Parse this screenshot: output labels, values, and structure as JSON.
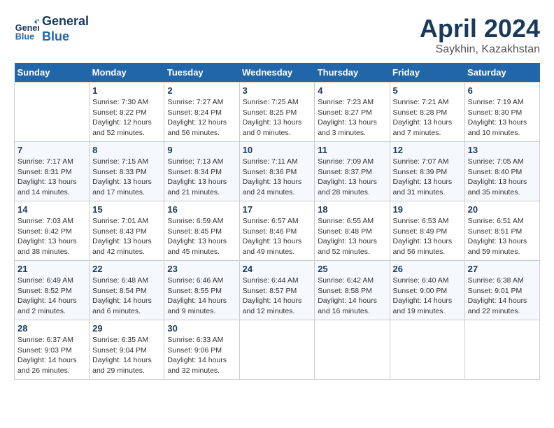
{
  "header": {
    "logo_line1": "General",
    "logo_line2": "Blue",
    "month": "April 2024",
    "location": "Saykhin, Kazakhstan"
  },
  "weekdays": [
    "Sunday",
    "Monday",
    "Tuesday",
    "Wednesday",
    "Thursday",
    "Friday",
    "Saturday"
  ],
  "weeks": [
    [
      {
        "day": "",
        "info": ""
      },
      {
        "day": "1",
        "info": "Sunrise: 7:30 AM\nSunset: 8:22 PM\nDaylight: 12 hours\nand 52 minutes."
      },
      {
        "day": "2",
        "info": "Sunrise: 7:27 AM\nSunset: 8:24 PM\nDaylight: 12 hours\nand 56 minutes."
      },
      {
        "day": "3",
        "info": "Sunrise: 7:25 AM\nSunset: 8:25 PM\nDaylight: 13 hours\nand 0 minutes."
      },
      {
        "day": "4",
        "info": "Sunrise: 7:23 AM\nSunset: 8:27 PM\nDaylight: 13 hours\nand 3 minutes."
      },
      {
        "day": "5",
        "info": "Sunrise: 7:21 AM\nSunset: 8:28 PM\nDaylight: 13 hours\nand 7 minutes."
      },
      {
        "day": "6",
        "info": "Sunrise: 7:19 AM\nSunset: 8:30 PM\nDaylight: 13 hours\nand 10 minutes."
      }
    ],
    [
      {
        "day": "7",
        "info": "Sunrise: 7:17 AM\nSunset: 8:31 PM\nDaylight: 13 hours\nand 14 minutes."
      },
      {
        "day": "8",
        "info": "Sunrise: 7:15 AM\nSunset: 8:33 PM\nDaylight: 13 hours\nand 17 minutes."
      },
      {
        "day": "9",
        "info": "Sunrise: 7:13 AM\nSunset: 8:34 PM\nDaylight: 13 hours\nand 21 minutes."
      },
      {
        "day": "10",
        "info": "Sunrise: 7:11 AM\nSunset: 8:36 PM\nDaylight: 13 hours\nand 24 minutes."
      },
      {
        "day": "11",
        "info": "Sunrise: 7:09 AM\nSunset: 8:37 PM\nDaylight: 13 hours\nand 28 minutes."
      },
      {
        "day": "12",
        "info": "Sunrise: 7:07 AM\nSunset: 8:39 PM\nDaylight: 13 hours\nand 31 minutes."
      },
      {
        "day": "13",
        "info": "Sunrise: 7:05 AM\nSunset: 8:40 PM\nDaylight: 13 hours\nand 35 minutes."
      }
    ],
    [
      {
        "day": "14",
        "info": "Sunrise: 7:03 AM\nSunset: 8:42 PM\nDaylight: 13 hours\nand 38 minutes."
      },
      {
        "day": "15",
        "info": "Sunrise: 7:01 AM\nSunset: 8:43 PM\nDaylight: 13 hours\nand 42 minutes."
      },
      {
        "day": "16",
        "info": "Sunrise: 6:59 AM\nSunset: 8:45 PM\nDaylight: 13 hours\nand 45 minutes."
      },
      {
        "day": "17",
        "info": "Sunrise: 6:57 AM\nSunset: 8:46 PM\nDaylight: 13 hours\nand 49 minutes."
      },
      {
        "day": "18",
        "info": "Sunrise: 6:55 AM\nSunset: 8:48 PM\nDaylight: 13 hours\nand 52 minutes."
      },
      {
        "day": "19",
        "info": "Sunrise: 6:53 AM\nSunset: 8:49 PM\nDaylight: 13 hours\nand 56 minutes."
      },
      {
        "day": "20",
        "info": "Sunrise: 6:51 AM\nSunset: 8:51 PM\nDaylight: 13 hours\nand 59 minutes."
      }
    ],
    [
      {
        "day": "21",
        "info": "Sunrise: 6:49 AM\nSunset: 8:52 PM\nDaylight: 14 hours\nand 2 minutes."
      },
      {
        "day": "22",
        "info": "Sunrise: 6:48 AM\nSunset: 8:54 PM\nDaylight: 14 hours\nand 6 minutes."
      },
      {
        "day": "23",
        "info": "Sunrise: 6:46 AM\nSunset: 8:55 PM\nDaylight: 14 hours\nand 9 minutes."
      },
      {
        "day": "24",
        "info": "Sunrise: 6:44 AM\nSunset: 8:57 PM\nDaylight: 14 hours\nand 12 minutes."
      },
      {
        "day": "25",
        "info": "Sunrise: 6:42 AM\nSunset: 8:58 PM\nDaylight: 14 hours\nand 16 minutes."
      },
      {
        "day": "26",
        "info": "Sunrise: 6:40 AM\nSunset: 9:00 PM\nDaylight: 14 hours\nand 19 minutes."
      },
      {
        "day": "27",
        "info": "Sunrise: 6:38 AM\nSunset: 9:01 PM\nDaylight: 14 hours\nand 22 minutes."
      }
    ],
    [
      {
        "day": "28",
        "info": "Sunrise: 6:37 AM\nSunset: 9:03 PM\nDaylight: 14 hours\nand 26 minutes."
      },
      {
        "day": "29",
        "info": "Sunrise: 6:35 AM\nSunset: 9:04 PM\nDaylight: 14 hours\nand 29 minutes."
      },
      {
        "day": "30",
        "info": "Sunrise: 6:33 AM\nSunset: 9:06 PM\nDaylight: 14 hours\nand 32 minutes."
      },
      {
        "day": "",
        "info": ""
      },
      {
        "day": "",
        "info": ""
      },
      {
        "day": "",
        "info": ""
      },
      {
        "day": "",
        "info": ""
      }
    ]
  ]
}
